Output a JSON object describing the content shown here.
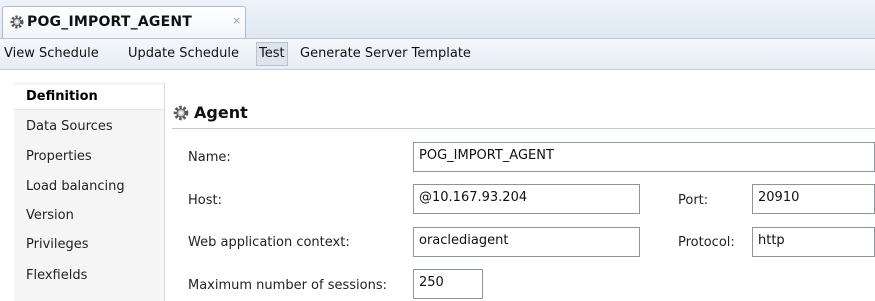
{
  "tab": {
    "title": "POG_IMPORT_AGENT",
    "close": "×",
    "icon": "gear-icon"
  },
  "menu": [
    {
      "label": "View Schedule"
    },
    {
      "label": "Update Schedule"
    },
    {
      "label": "Test",
      "active": true
    },
    {
      "label": "Generate Server Template"
    }
  ],
  "sidebar": {
    "items": [
      {
        "label": "Definition",
        "active": true
      },
      {
        "label": "Data Sources"
      },
      {
        "label": "Properties"
      },
      {
        "label": "Load balancing"
      },
      {
        "label": "Version"
      },
      {
        "label": "Privileges"
      },
      {
        "label": "Flexfields"
      }
    ]
  },
  "section": {
    "title": "Agent",
    "icon": "gear-icon"
  },
  "form": {
    "name_label": "Name:",
    "name_value": "POG_IMPORT_AGENT",
    "host_label": "Host:",
    "host_value": "@10.167.93.204",
    "port_label": "Port:",
    "port_value": "20910",
    "context_label": "Web application context:",
    "context_value": "oraclediagent",
    "protocol_label": "Protocol:",
    "protocol_value": "http",
    "sessions_label": "Maximum number of sessions:",
    "sessions_value": "250"
  },
  "colors": {
    "tab_bg": "#eef3f9",
    "field_border": "#8c949c",
    "sidebar_bg": "#f5f5f5"
  }
}
